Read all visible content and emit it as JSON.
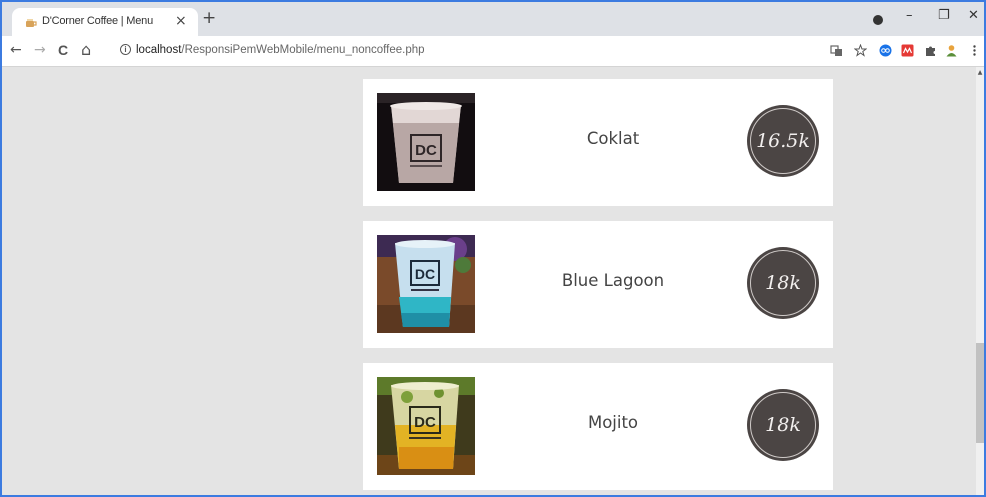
{
  "browser": {
    "tab_title": "D'Corner Coffee | Menu",
    "tab_close": "×",
    "new_tab": "+",
    "url_host": "localhost",
    "url_path": "/ResponsiPemWebMobile/menu_noncoffee.php",
    "info_symbol": "i",
    "controls": {
      "minimize": "–",
      "restore": "❐",
      "close": "✕"
    },
    "nav": {
      "back": "←",
      "forward": "→",
      "reload": "C",
      "home": "⌂"
    },
    "toolbar_icons": [
      "translate-icon",
      "star-icon",
      "extension-icon",
      "extension-icon",
      "puzzle-icon",
      "profile-icon",
      "menu-icon"
    ],
    "accent_color": "#3c7be0"
  },
  "menu": {
    "items": [
      {
        "name": "Coklat",
        "price": "16.5k"
      },
      {
        "name": "Blue Lagoon",
        "price": "18k"
      },
      {
        "name": "Mojito",
        "price": "18k"
      }
    ],
    "logo_text": "DC",
    "price_badge_color": "#4b4544"
  }
}
